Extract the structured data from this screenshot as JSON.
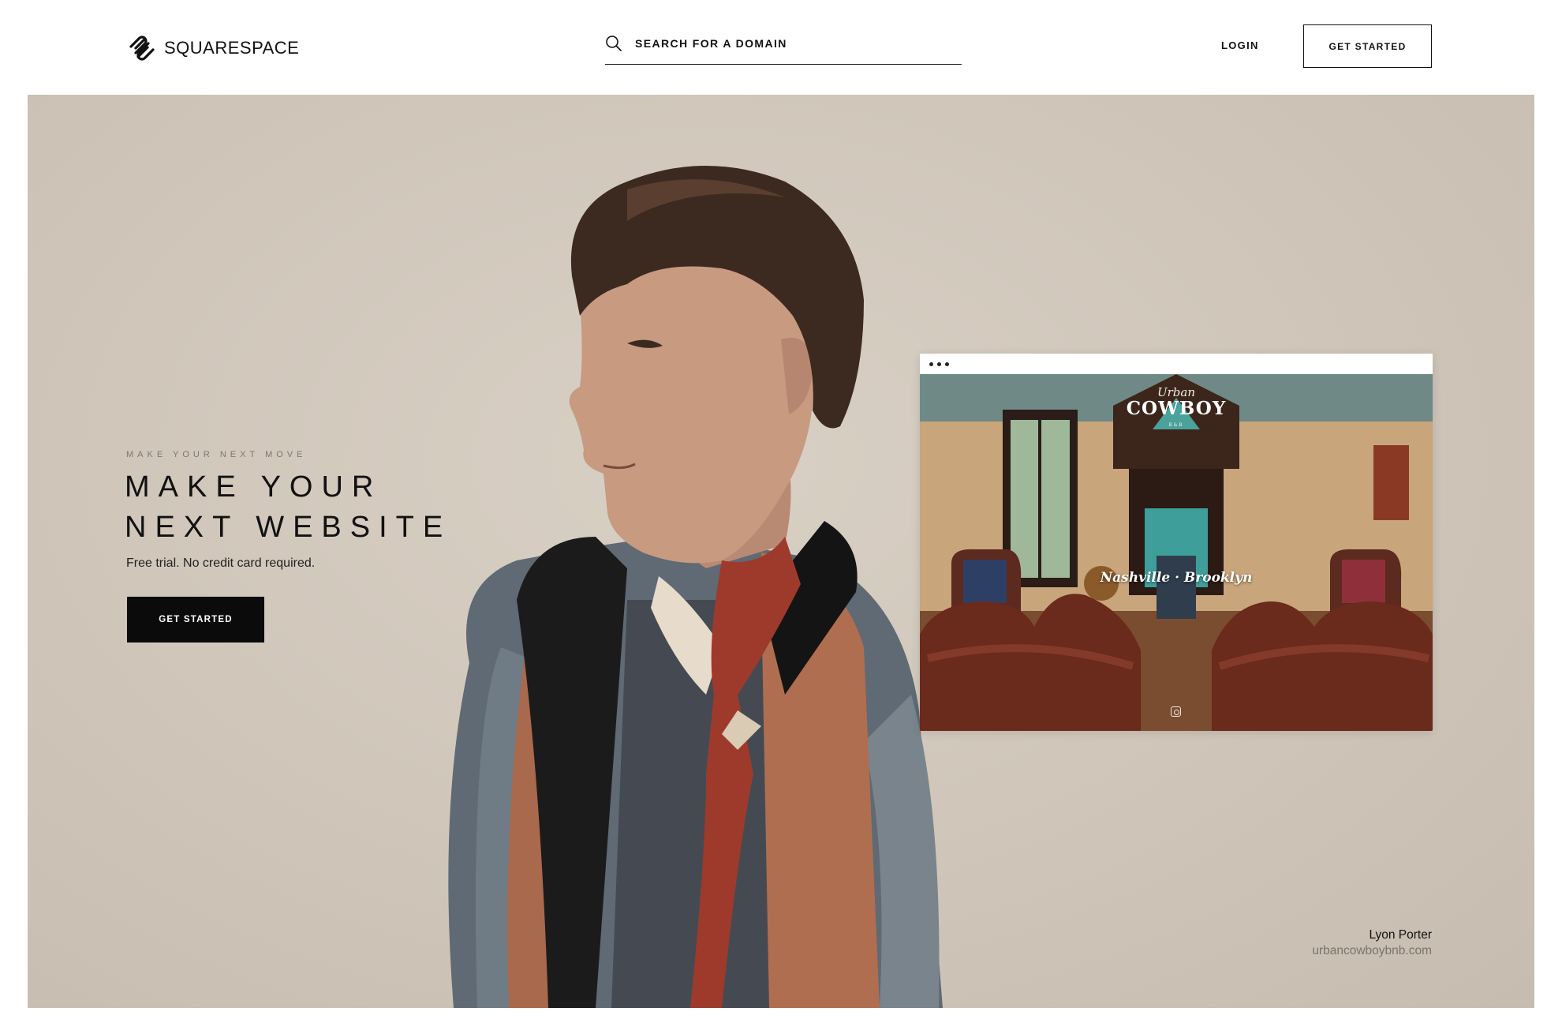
{
  "header": {
    "brand": "SQUARESPACE",
    "search_placeholder": "SEARCH FOR A DOMAIN",
    "login_label": "LOGIN",
    "cta_label": "GET STARTED"
  },
  "hero": {
    "eyebrow": "MAKE YOUR NEXT MOVE",
    "headline_line1": "MAKE YOUR",
    "headline_line2": "NEXT WEBSITE",
    "subtext": "Free trial. No credit card required.",
    "cta_label": "GET STARTED"
  },
  "showcase": {
    "site_brand_top": "Urban",
    "site_brand_main": "COWBOY",
    "site_brand_sub": "B&B",
    "site_locations": "Nashville · Brooklyn",
    "customer_name": "Lyon Porter",
    "customer_url": "urbancowboybnb.com"
  },
  "icons": {
    "logo": "squarespace-logo-icon",
    "search": "search-icon",
    "instagram": "instagram-icon"
  },
  "colors": {
    "hero_background": "#d3c9bd",
    "cta_dark": "#0b0b0b",
    "text_primary": "#111111",
    "text_muted": "#7a746d"
  }
}
